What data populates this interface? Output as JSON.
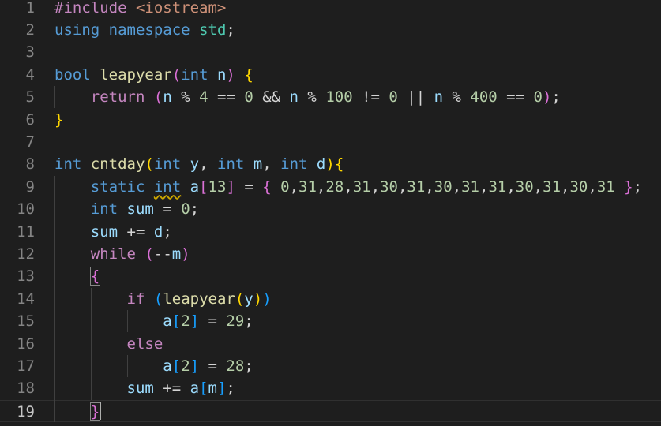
{
  "colors": {
    "background": "#1e1e1e",
    "keyword": "#569cd6",
    "control": "#c586c0",
    "function": "#dcdcaa",
    "variable": "#9cdcfe",
    "number": "#b5cea8",
    "string": "#ce9178",
    "namespace": "#4ec9b0",
    "text": "#d4d4d4",
    "bracket1": "#ffd700",
    "bracket2": "#da70d6",
    "bracket3": "#179fff",
    "line_number": "#858585",
    "line_number_active": "#c6c6c6"
  },
  "editor": {
    "active_line": 19,
    "lines": [
      {
        "n": 1,
        "tokens": [
          {
            "t": "#include",
            "c": "control"
          },
          {
            "t": " ",
            "c": "text"
          },
          {
            "t": "<iostream>",
            "c": "string"
          }
        ]
      },
      {
        "n": 2,
        "tokens": [
          {
            "t": "using",
            "c": "keyword"
          },
          {
            "t": " ",
            "c": "text"
          },
          {
            "t": "namespace",
            "c": "keyword"
          },
          {
            "t": " ",
            "c": "text"
          },
          {
            "t": "std",
            "c": "namespace"
          },
          {
            "t": ";",
            "c": "text"
          }
        ]
      },
      {
        "n": 3,
        "tokens": []
      },
      {
        "n": 4,
        "tokens": [
          {
            "t": "bool",
            "c": "keyword"
          },
          {
            "t": " ",
            "c": "text"
          },
          {
            "t": "leapyear",
            "c": "function"
          },
          {
            "t": "(",
            "c": "bracket2"
          },
          {
            "t": "int",
            "c": "keyword"
          },
          {
            "t": " ",
            "c": "text"
          },
          {
            "t": "n",
            "c": "variable"
          },
          {
            "t": ")",
            "c": "bracket2"
          },
          {
            "t": " ",
            "c": "text"
          },
          {
            "t": "{",
            "c": "bracket1"
          }
        ]
      },
      {
        "n": 5,
        "tokens": [
          {
            "t": "    ",
            "c": "text"
          },
          {
            "t": "return",
            "c": "control"
          },
          {
            "t": " ",
            "c": "text"
          },
          {
            "t": "(",
            "c": "bracket2"
          },
          {
            "t": "n",
            "c": "variable"
          },
          {
            "t": " % ",
            "c": "text"
          },
          {
            "t": "4",
            "c": "number"
          },
          {
            "t": " == ",
            "c": "text"
          },
          {
            "t": "0",
            "c": "number"
          },
          {
            "t": " && ",
            "c": "text"
          },
          {
            "t": "n",
            "c": "variable"
          },
          {
            "t": " % ",
            "c": "text"
          },
          {
            "t": "100",
            "c": "number"
          },
          {
            "t": " != ",
            "c": "text"
          },
          {
            "t": "0",
            "c": "number"
          },
          {
            "t": " || ",
            "c": "text"
          },
          {
            "t": "n",
            "c": "variable"
          },
          {
            "t": " % ",
            "c": "text"
          },
          {
            "t": "400",
            "c": "number"
          },
          {
            "t": " == ",
            "c": "text"
          },
          {
            "t": "0",
            "c": "number"
          },
          {
            "t": ")",
            "c": "bracket2"
          },
          {
            "t": ";",
            "c": "text"
          }
        ]
      },
      {
        "n": 6,
        "tokens": [
          {
            "t": "}",
            "c": "bracket1"
          }
        ]
      },
      {
        "n": 7,
        "tokens": []
      },
      {
        "n": 8,
        "tokens": [
          {
            "t": "int",
            "c": "keyword"
          },
          {
            "t": " ",
            "c": "text"
          },
          {
            "t": "cntday",
            "c": "function"
          },
          {
            "t": "(",
            "c": "bracket1"
          },
          {
            "t": "int",
            "c": "keyword"
          },
          {
            "t": " ",
            "c": "text"
          },
          {
            "t": "y",
            "c": "variable"
          },
          {
            "t": ", ",
            "c": "text"
          },
          {
            "t": "int",
            "c": "keyword"
          },
          {
            "t": " ",
            "c": "text"
          },
          {
            "t": "m",
            "c": "variable"
          },
          {
            "t": ", ",
            "c": "text"
          },
          {
            "t": "int",
            "c": "keyword"
          },
          {
            "t": " ",
            "c": "text"
          },
          {
            "t": "d",
            "c": "variable"
          },
          {
            "t": ")",
            "c": "bracket1"
          },
          {
            "t": "{",
            "c": "bracket1"
          }
        ]
      },
      {
        "n": 9,
        "tokens": [
          {
            "t": "    ",
            "c": "text"
          },
          {
            "t": "static",
            "c": "keyword"
          },
          {
            "t": " ",
            "c": "text"
          },
          {
            "t": "int",
            "c": "keyword",
            "squiggle": true
          },
          {
            "t": " ",
            "c": "text"
          },
          {
            "t": "a",
            "c": "variable"
          },
          {
            "t": "[",
            "c": "bracket2"
          },
          {
            "t": "13",
            "c": "number"
          },
          {
            "t": "]",
            "c": "bracket2"
          },
          {
            "t": " = ",
            "c": "text"
          },
          {
            "t": "{",
            "c": "bracket2"
          },
          {
            "t": " ",
            "c": "text"
          },
          {
            "t": "0",
            "c": "number"
          },
          {
            "t": ",",
            "c": "text"
          },
          {
            "t": "31",
            "c": "number"
          },
          {
            "t": ",",
            "c": "text"
          },
          {
            "t": "28",
            "c": "number"
          },
          {
            "t": ",",
            "c": "text"
          },
          {
            "t": "31",
            "c": "number"
          },
          {
            "t": ",",
            "c": "text"
          },
          {
            "t": "30",
            "c": "number"
          },
          {
            "t": ",",
            "c": "text"
          },
          {
            "t": "31",
            "c": "number"
          },
          {
            "t": ",",
            "c": "text"
          },
          {
            "t": "30",
            "c": "number"
          },
          {
            "t": ",",
            "c": "text"
          },
          {
            "t": "31",
            "c": "number"
          },
          {
            "t": ",",
            "c": "text"
          },
          {
            "t": "31",
            "c": "number"
          },
          {
            "t": ",",
            "c": "text"
          },
          {
            "t": "30",
            "c": "number"
          },
          {
            "t": ",",
            "c": "text"
          },
          {
            "t": "31",
            "c": "number"
          },
          {
            "t": ",",
            "c": "text"
          },
          {
            "t": "30",
            "c": "number"
          },
          {
            "t": ",",
            "c": "text"
          },
          {
            "t": "31",
            "c": "number"
          },
          {
            "t": " ",
            "c": "text"
          },
          {
            "t": "}",
            "c": "bracket2"
          },
          {
            "t": ";",
            "c": "text"
          }
        ]
      },
      {
        "n": 10,
        "tokens": [
          {
            "t": "    ",
            "c": "text"
          },
          {
            "t": "int",
            "c": "keyword"
          },
          {
            "t": " ",
            "c": "text"
          },
          {
            "t": "sum",
            "c": "variable"
          },
          {
            "t": " = ",
            "c": "text"
          },
          {
            "t": "0",
            "c": "number"
          },
          {
            "t": ";",
            "c": "text"
          }
        ]
      },
      {
        "n": 11,
        "tokens": [
          {
            "t": "    ",
            "c": "text"
          },
          {
            "t": "sum",
            "c": "variable"
          },
          {
            "t": " += ",
            "c": "text"
          },
          {
            "t": "d",
            "c": "variable"
          },
          {
            "t": ";",
            "c": "text"
          }
        ]
      },
      {
        "n": 12,
        "tokens": [
          {
            "t": "    ",
            "c": "text"
          },
          {
            "t": "while",
            "c": "control"
          },
          {
            "t": " ",
            "c": "text"
          },
          {
            "t": "(",
            "c": "bracket2"
          },
          {
            "t": "--",
            "c": "text"
          },
          {
            "t": "m",
            "c": "variable"
          },
          {
            "t": ")",
            "c": "bracket2"
          }
        ]
      },
      {
        "n": 13,
        "tokens": [
          {
            "t": "    ",
            "c": "text"
          },
          {
            "t": "{",
            "c": "bracket2",
            "box": true
          }
        ]
      },
      {
        "n": 14,
        "tokens": [
          {
            "t": "        ",
            "c": "text"
          },
          {
            "t": "if",
            "c": "control"
          },
          {
            "t": " ",
            "c": "text"
          },
          {
            "t": "(",
            "c": "bracket3"
          },
          {
            "t": "leapyear",
            "c": "function"
          },
          {
            "t": "(",
            "c": "bracket1"
          },
          {
            "t": "y",
            "c": "variable"
          },
          {
            "t": ")",
            "c": "bracket1"
          },
          {
            "t": ")",
            "c": "bracket3"
          }
        ]
      },
      {
        "n": 15,
        "tokens": [
          {
            "t": "            ",
            "c": "text"
          },
          {
            "t": "a",
            "c": "variable"
          },
          {
            "t": "[",
            "c": "bracket3"
          },
          {
            "t": "2",
            "c": "number"
          },
          {
            "t": "]",
            "c": "bracket3"
          },
          {
            "t": " = ",
            "c": "text"
          },
          {
            "t": "29",
            "c": "number"
          },
          {
            "t": ";",
            "c": "text"
          }
        ]
      },
      {
        "n": 16,
        "tokens": [
          {
            "t": "        ",
            "c": "text"
          },
          {
            "t": "else",
            "c": "control"
          }
        ]
      },
      {
        "n": 17,
        "tokens": [
          {
            "t": "            ",
            "c": "text"
          },
          {
            "t": "a",
            "c": "variable"
          },
          {
            "t": "[",
            "c": "bracket3"
          },
          {
            "t": "2",
            "c": "number"
          },
          {
            "t": "]",
            "c": "bracket3"
          },
          {
            "t": " = ",
            "c": "text"
          },
          {
            "t": "28",
            "c": "number"
          },
          {
            "t": ";",
            "c": "text"
          }
        ]
      },
      {
        "n": 18,
        "tokens": [
          {
            "t": "        ",
            "c": "text"
          },
          {
            "t": "sum",
            "c": "variable"
          },
          {
            "t": " += ",
            "c": "text"
          },
          {
            "t": "a",
            "c": "variable"
          },
          {
            "t": "[",
            "c": "bracket3"
          },
          {
            "t": "m",
            "c": "variable"
          },
          {
            "t": "]",
            "c": "bracket3"
          },
          {
            "t": ";",
            "c": "text"
          }
        ]
      },
      {
        "n": 19,
        "tokens": [
          {
            "t": "    ",
            "c": "text"
          },
          {
            "t": "}",
            "c": "bracket2",
            "box": true
          }
        ]
      }
    ]
  }
}
